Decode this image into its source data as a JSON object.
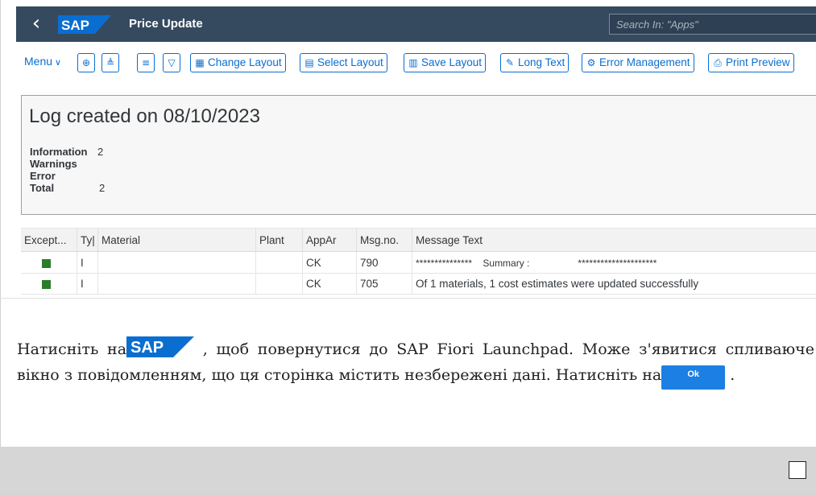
{
  "shell": {
    "back_icon": "chevron-left-icon",
    "logo_text": "SAP",
    "title": "Price Update",
    "search_placeholder": "Search In: \"Apps\"",
    "brand_color": "#354a5f",
    "logo_color": "#0a6ed1"
  },
  "toolbar": {
    "menu_label": "Menu",
    "icon_buttons": [
      "zoom-icon",
      "sort-ascending-icon",
      "sort-descending-icon",
      "filter-icon"
    ],
    "buttons": [
      {
        "label": "Change Layout",
        "icon": "table-icon"
      },
      {
        "label": "Select Layout",
        "icon": "layout-icon"
      },
      {
        "label": "Save Layout",
        "icon": "save-layout-icon"
      },
      {
        "label": "Long Text",
        "icon": "long-text-icon"
      },
      {
        "label": "Error Management",
        "icon": "wrench-icon"
      },
      {
        "label": "Print Preview",
        "icon": "print-preview-icon"
      }
    ]
  },
  "log": {
    "title": "Log created on 08/10/2023",
    "stats": [
      {
        "label": "Information",
        "value": "2"
      },
      {
        "label": "Warnings",
        "value": ""
      },
      {
        "label": "Error",
        "value": ""
      },
      {
        "label": "Total",
        "value": "2"
      }
    ]
  },
  "grid": {
    "headers": [
      "Except...",
      "Ty|",
      "Material",
      "Plant",
      "AppAr",
      "Msg.no.",
      "Message Text"
    ],
    "rows": [
      {
        "exception": "green",
        "type": "I",
        "material": "",
        "plant": "",
        "appar": "CK",
        "msgno": "790",
        "text": "***************    Summary :                  *********************"
      },
      {
        "exception": "green",
        "type": "I",
        "material": "",
        "plant": "",
        "appar": "CK",
        "msgno": "705",
        "text": "Of 1 materials, 1 cost estimates were updated successfully"
      }
    ],
    "status_color": "#2b7c2b"
  },
  "instructions": {
    "part1": "Натисніть на",
    "part2": " , щоб повернутися до SAP Fiori Launchpad. Може з'явитися спливаюче вікно з повідомленням, що ця сторінка містить незбережені дані. Натисніть на",
    "part3": " .",
    "inline_logo_text": "SAP",
    "ok_label": "Ok"
  }
}
